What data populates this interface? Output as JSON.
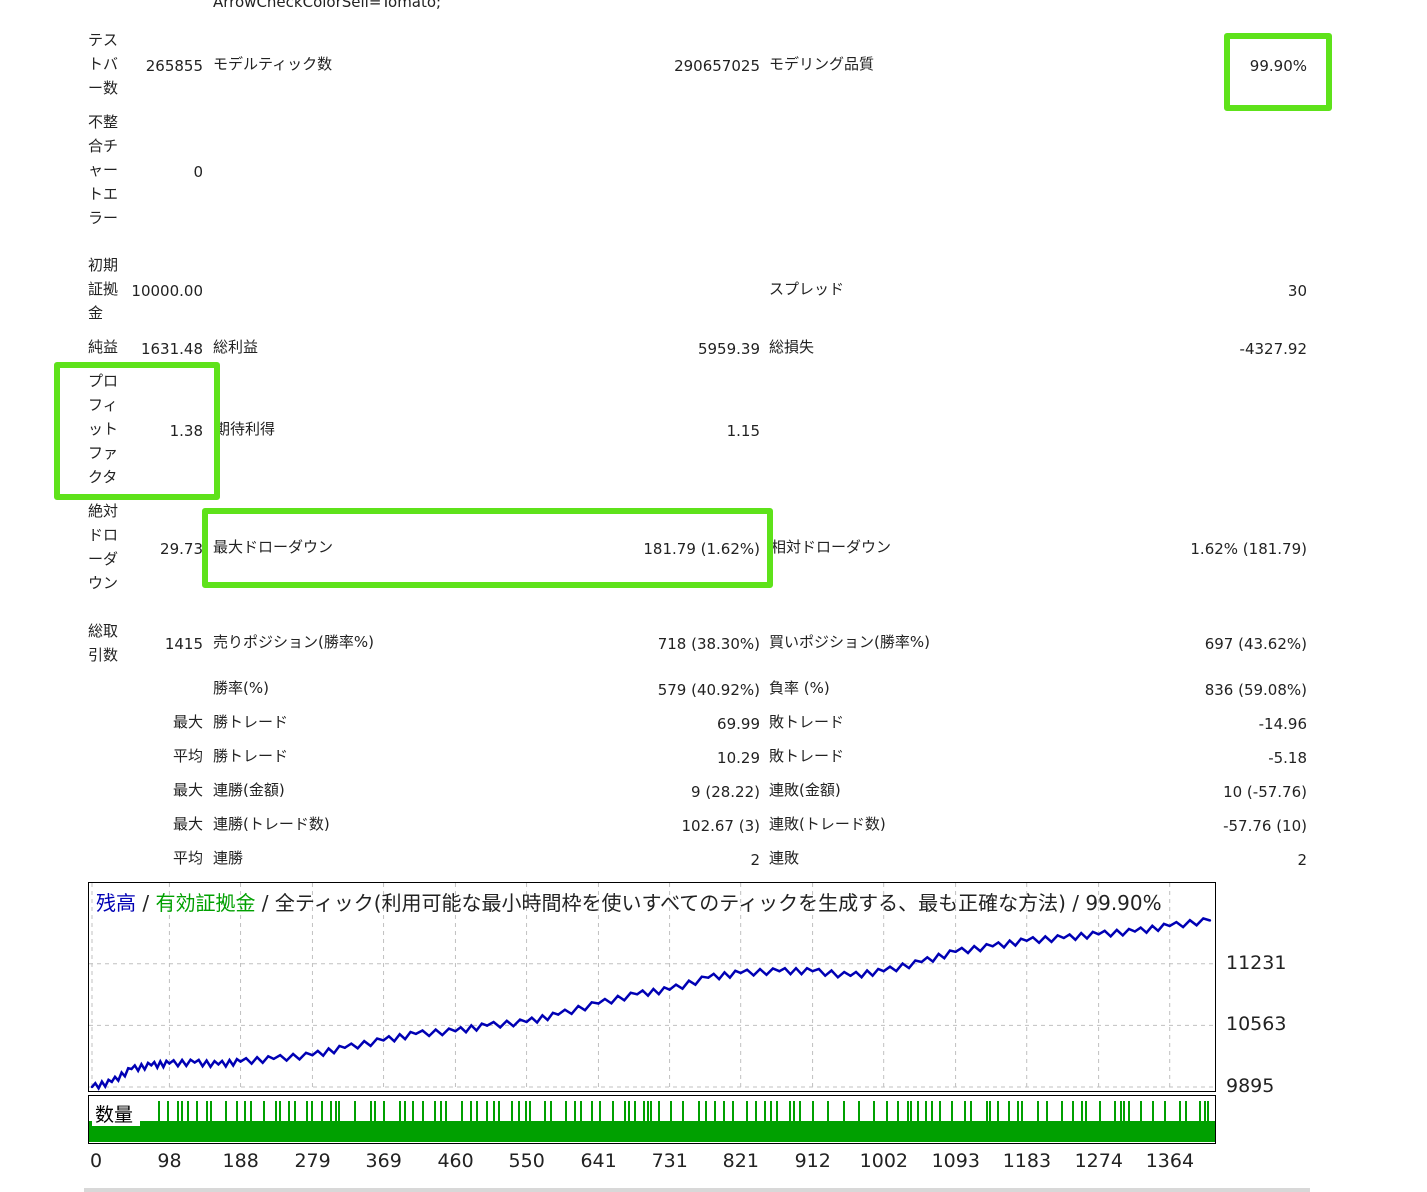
{
  "header_fragment": "ArrowCheckColorSell=Tomato;",
  "rows": {
    "test_bars": {
      "label": "テストバー数",
      "value": "265855",
      "label2": "モデルティック数",
      "value2": "290657025",
      "label3": "モデリング品質",
      "value3": "99.90%"
    },
    "mismatch": {
      "label": "不整合チャートエラー",
      "value": "0"
    },
    "deposit": {
      "label": "初期証拠金",
      "value": "10000.00",
      "label3": "スプレッド",
      "value3": "30"
    },
    "net": {
      "label": "純益",
      "value": "1631.48",
      "label2": "総利益",
      "value2": "5959.39",
      "label3": "総損失",
      "value3": "-4327.92"
    },
    "pf": {
      "label": "プロフィットファクタ",
      "value": "1.38",
      "label2": "期待利得",
      "value2": "1.15"
    },
    "abs_dd": {
      "label": "絶対ドローダウン",
      "value": "29.73",
      "label2": "最大ドローダウン",
      "value2": "181.79 (1.62%)",
      "label3": "相対ドローダウン",
      "value3": "1.62% (181.79)"
    },
    "trades": {
      "label": "総取引数",
      "value": "1415",
      "label2": "売りポジション(勝率%)",
      "value2": "718 (38.30%)",
      "label3": "買いポジション(勝率%)",
      "value3": "697 (43.62%)"
    },
    "winrate": {
      "label2": "勝率(%)",
      "value2": "579 (40.92%)",
      "label3": "負率 (%)",
      "value3": "836 (59.08%)"
    },
    "max_trade": {
      "prefix": "最大",
      "label2": "勝トレード",
      "value2": "69.99",
      "label3": "敗トレード",
      "value3": "-14.96"
    },
    "avg_trade": {
      "prefix": "平均",
      "label2": "勝トレード",
      "value2": "10.29",
      "label3": "敗トレード",
      "value3": "-5.18"
    },
    "max_cons_amt": {
      "prefix": "最大",
      "label2": "連勝(金額)",
      "value2": "9 (28.22)",
      "label3": "連敗(金額)",
      "value3": "10 (-57.76)"
    },
    "max_cons_cnt": {
      "prefix": "最大",
      "label2": "連勝(トレード数)",
      "value2": "102.67 (3)",
      "label3": "連敗(トレード数)",
      "value3": "-57.76 (10)"
    },
    "avg_cons": {
      "prefix": "平均",
      "label2": "連勝",
      "value2": "2",
      "label3": "連敗",
      "value3": "2"
    }
  },
  "chart": {
    "title_balance": "残高",
    "title_sep1": " / ",
    "title_equity": "有効証拠金",
    "title_rest": " / 全ティック(利用可能な最小時間枠を使いすべてのティックを生成する、最も正確な方法) / 99.90%",
    "volume_label": "数量",
    "balance_color": "#0000b4",
    "equity_color": "#00a000",
    "highlight_color": "#5ee21a"
  },
  "chart_data": {
    "type": "line",
    "series": [
      {
        "name": "残高"
      }
    ],
    "x_ticks": [
      0,
      98,
      188,
      279,
      369,
      460,
      550,
      641,
      731,
      821,
      912,
      1002,
      1093,
      1183,
      1274,
      1364
    ],
    "y_ticks": [
      9895,
      10563,
      11231
    ],
    "ylim": [
      9895,
      11900
    ],
    "xlim": [
      0,
      1415
    ],
    "x": [
      0,
      25,
      50,
      75,
      98,
      130,
      160,
      188,
      230,
      279,
      320,
      369,
      410,
      460,
      500,
      550,
      590,
      641,
      690,
      731,
      780,
      821,
      870,
      912,
      960,
      1002,
      1050,
      1093,
      1140,
      1183,
      1230,
      1274,
      1320,
      1364,
      1415
    ],
    "values": [
      9895,
      9950,
      10090,
      10130,
      10150,
      10160,
      10140,
      10170,
      10200,
      10240,
      10320,
      10400,
      10470,
      10500,
      10560,
      10600,
      10680,
      10800,
      10900,
      10950,
      11080,
      11130,
      11150,
      11150,
      11100,
      11150,
      11250,
      11360,
      11420,
      11480,
      11510,
      11550,
      11580,
      11640,
      11700
    ]
  }
}
